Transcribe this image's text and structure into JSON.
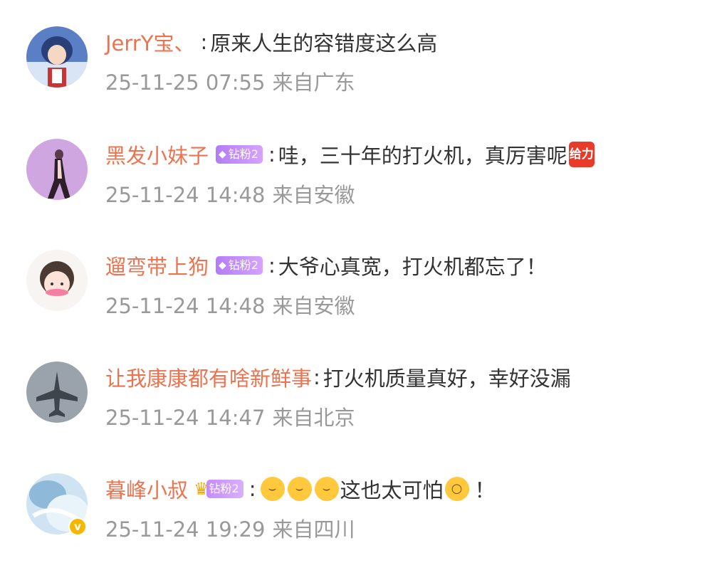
{
  "comments": [
    {
      "user": "JerrY宝、",
      "text": "原来人生的容错度这么高",
      "time": "25-11-25 07:55",
      "location": "来自广东"
    },
    {
      "user": "黑发小妹子",
      "badge": "钻粉2",
      "text": "哇，三十年的打火机，真厉害呢",
      "tag": "给力",
      "time": "25-11-24 14:48",
      "location": "来自安徽"
    },
    {
      "user": "遛弯带上狗",
      "badge": "钻粉2",
      "text": "大爷心真宽，打火机都忘了！",
      "time": "25-11-24 14:48",
      "location": "来自安徽"
    },
    {
      "user": "让我康康都有啥新鲜事",
      "text": "打火机质量真好，幸好没漏",
      "time": "25-11-24 14:47",
      "location": "来自北京"
    },
    {
      "user": "暮峰小叔",
      "badge": "钻粉2",
      "text": "这也太可怕",
      "text_end": "！",
      "verified": "v",
      "time": "25-11-24 19:29",
      "location": "来自四川"
    }
  ],
  "separator": ":",
  "icons": {
    "badge_gem": "diamond-icon",
    "crown": "crown-icon",
    "laugh_cry": "laugh-cry-emoji",
    "shocked": "shocked-emoji"
  },
  "colors": {
    "username": "#eb7350",
    "text": "#333333",
    "meta": "#999999",
    "badge": "#b47cf5"
  }
}
